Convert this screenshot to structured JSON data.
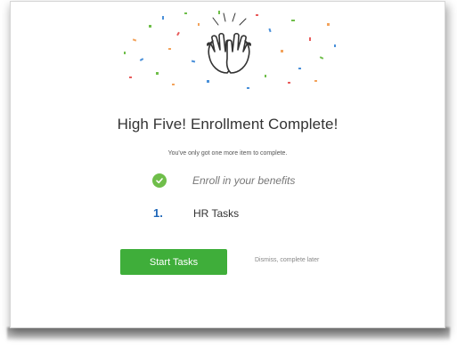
{
  "modal": {
    "title": "High Five! Enrollment Complete!",
    "subtitle": "You've only got one more item to complete.",
    "items": [
      {
        "status": "complete",
        "icon": "check-circle-icon",
        "label": "Enroll in your benefits"
      },
      {
        "status": "pending",
        "number": "1.",
        "label": "HR Tasks"
      }
    ],
    "primary_button": "Start Tasks",
    "dismiss_link": "Dismiss, complete later"
  },
  "colors": {
    "primary_green": "#3fae3a",
    "check_green": "#6fbe4a",
    "number_blue": "#1e66b8",
    "title_text": "#333333"
  },
  "illustration": {
    "icon": "high-five-hands-icon",
    "decoration": "confetti"
  }
}
